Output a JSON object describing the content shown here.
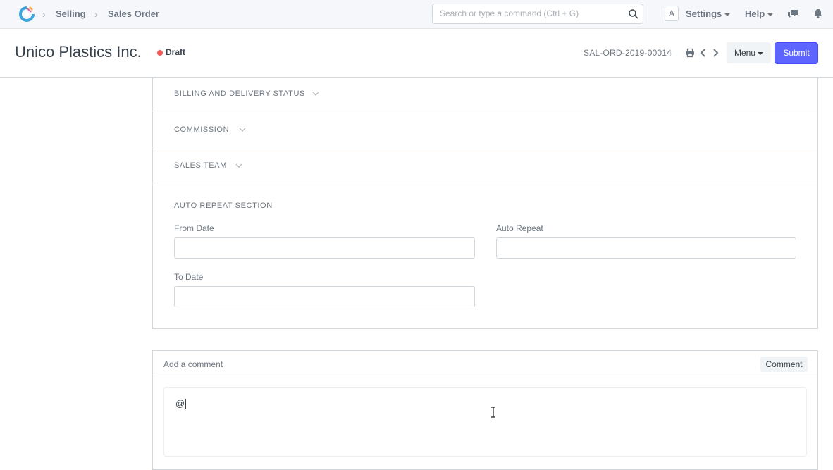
{
  "navbar": {
    "breadcrumbs": [
      "Selling",
      "Sales Order"
    ],
    "search_placeholder": "Search or type a command (Ctrl + G)",
    "avatar_letter": "A",
    "settings_label": "Settings",
    "help_label": "Help"
  },
  "page": {
    "title": "Unico Plastics Inc.",
    "status": "Draft",
    "status_color": "#ff5858",
    "doc_name": "SAL-ORD-2019-00014",
    "menu_label": "Menu",
    "submit_label": "Submit",
    "accent_color": "#5e64ff"
  },
  "sections": {
    "billing": "BILLING AND DELIVERY STATUS",
    "commission": "COMMISSION",
    "sales_team": "SALES TEAM",
    "auto_repeat": "AUTO REPEAT SECTION"
  },
  "fields": {
    "from_date": {
      "label": "From Date",
      "value": ""
    },
    "auto_repeat": {
      "label": "Auto Repeat",
      "value": ""
    },
    "to_date": {
      "label": "To Date",
      "value": ""
    }
  },
  "comment": {
    "title": "Add a comment",
    "button_label": "Comment",
    "text": "@"
  }
}
